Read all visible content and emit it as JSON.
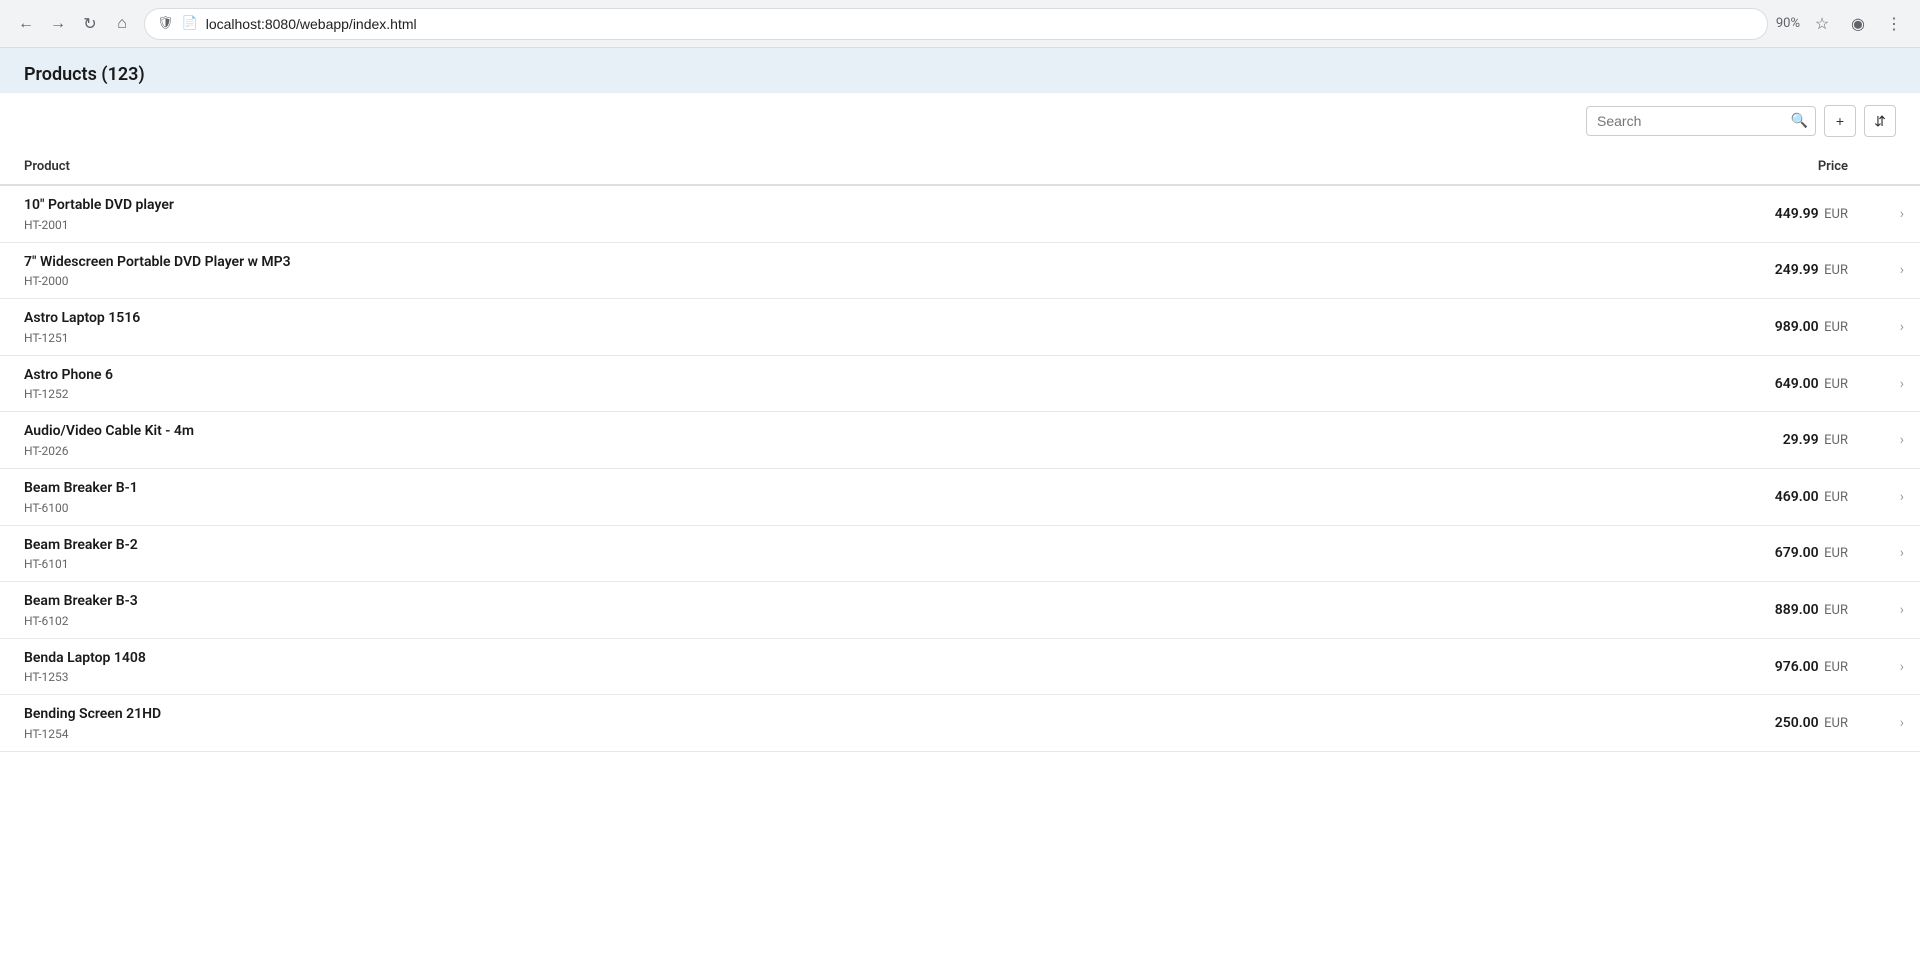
{
  "browser": {
    "url": "localhost:8080/webapp/index.html",
    "zoom": "90%",
    "back_disabled": false,
    "forward_disabled": false
  },
  "page": {
    "title": "Products (123)"
  },
  "toolbar": {
    "search_placeholder": "Search",
    "add_label": "+",
    "sort_label": "⇅"
  },
  "table": {
    "columns": {
      "product": "Product",
      "price": "Price"
    },
    "rows": [
      {
        "name": "10\" Portable DVD player",
        "id": "HT-2001",
        "price": "449.99",
        "currency": "EUR"
      },
      {
        "name": "7\" Widescreen Portable DVD Player w MP3",
        "id": "HT-2000",
        "price": "249.99",
        "currency": "EUR"
      },
      {
        "name": "Astro Laptop 1516",
        "id": "HT-1251",
        "price": "989.00",
        "currency": "EUR"
      },
      {
        "name": "Astro Phone 6",
        "id": "HT-1252",
        "price": "649.00",
        "currency": "EUR"
      },
      {
        "name": "Audio/Video Cable Kit - 4m",
        "id": "HT-2026",
        "price": "29.99",
        "currency": "EUR"
      },
      {
        "name": "Beam Breaker B-1",
        "id": "HT-6100",
        "price": "469.00",
        "currency": "EUR"
      },
      {
        "name": "Beam Breaker B-2",
        "id": "HT-6101",
        "price": "679.00",
        "currency": "EUR"
      },
      {
        "name": "Beam Breaker B-3",
        "id": "HT-6102",
        "price": "889.00",
        "currency": "EUR"
      },
      {
        "name": "Benda Laptop 1408",
        "id": "HT-1253",
        "price": "976.00",
        "currency": "EUR"
      },
      {
        "name": "Bending Screen 21HD",
        "id": "HT-1254",
        "price": "250.00",
        "currency": "EUR"
      }
    ]
  }
}
